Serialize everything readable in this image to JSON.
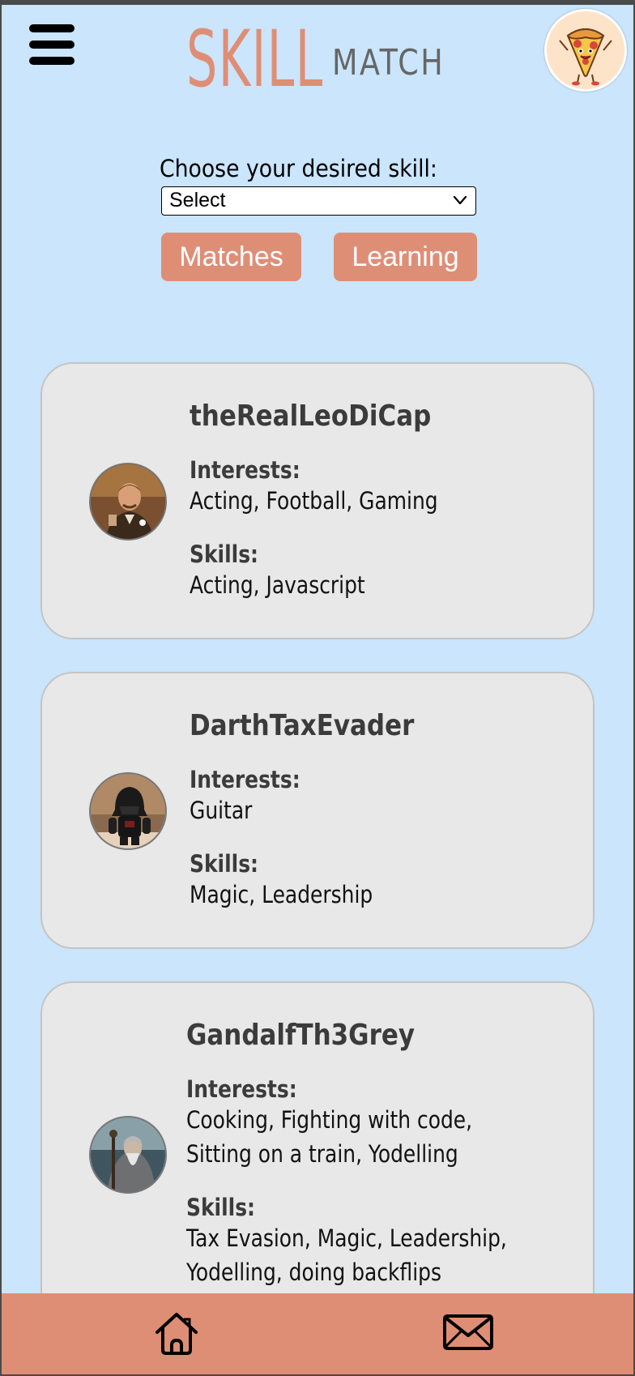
{
  "header": {
    "logo_primary": "SKILL",
    "logo_secondary": "MATCH",
    "menu_icon": "hamburger-menu-icon",
    "profile_avatar": "pizza-character-avatar"
  },
  "filter": {
    "label": "Choose your desired skill:",
    "select_value": "Select",
    "matches_label": "Matches",
    "learning_label": "Learning"
  },
  "profiles": [
    {
      "username": "theRealLeoDiCap",
      "interests_heading": "Interests:",
      "interests_line1": "Acting, Football, Gaming",
      "skills_heading": "Skills:",
      "skills_line1": "Acting, Javascript"
    },
    {
      "username": "DarthTaxEvader",
      "interests_heading": "Interests:",
      "interests_line1": "Guitar",
      "skills_heading": "Skills:",
      "skills_line1": "Magic, Leadership"
    },
    {
      "username": "GandalfTh3Grey",
      "interests_heading": "Interests:",
      "interests_line1": "Cooking, Fighting with code,",
      "interests_line2": "Sitting on a train, Yodelling",
      "skills_heading": "Skills:",
      "skills_line1": "Tax Evasion, Magic, Leadership,",
      "skills_line2": "Yodelling, doing backflips"
    }
  ],
  "nav": {
    "home_icon": "home-icon",
    "messages_icon": "envelope-icon"
  },
  "colors": {
    "background": "#cae5fc",
    "accent": "#df8e76",
    "card": "#e8e8e8"
  }
}
